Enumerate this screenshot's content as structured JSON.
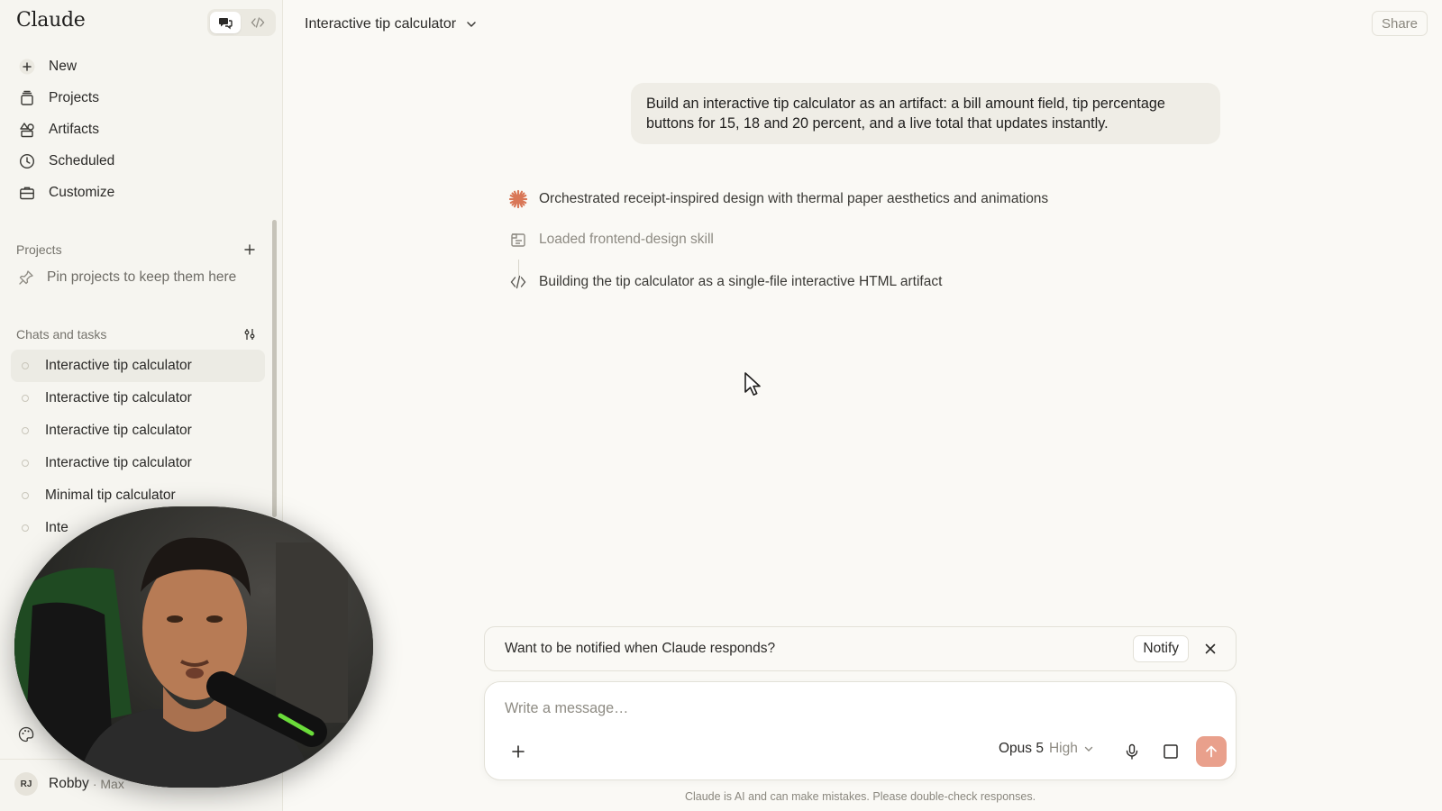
{
  "sidebar": {
    "brand": "Claude",
    "nav": [
      {
        "label": "New",
        "icon": "plus-icon"
      },
      {
        "label": "Projects",
        "icon": "projects-icon"
      },
      {
        "label": "Artifacts",
        "icon": "artifacts-icon"
      },
      {
        "label": "Scheduled",
        "icon": "clock-icon"
      },
      {
        "label": "Customize",
        "icon": "briefcase-icon"
      }
    ],
    "projects_header": "Projects",
    "pin_hint": "Pin projects to keep them here",
    "chats_header": "Chats and tasks",
    "chats": [
      {
        "title": "Interactive tip calculator"
      },
      {
        "title": "Interactive tip calculator"
      },
      {
        "title": "Interactive tip calculator"
      },
      {
        "title": "Interactive tip calculator"
      },
      {
        "title": "Minimal tip calculator"
      },
      {
        "title": "Inte"
      }
    ],
    "user": {
      "initials": "RJ",
      "name": "Robby",
      "plan": "· Max"
    }
  },
  "header": {
    "chat_title": "Interactive tip calculator",
    "share_label": "Share"
  },
  "conversation": {
    "user_message": "Build an interactive tip calculator as an artifact: a bill amount field, tip percentage buttons for 15, 18 and 20 percent, and a live total that updates instantly.",
    "steps": [
      {
        "text": "Orchestrated receipt-inspired design with thermal paper aesthetics and animations",
        "icon": "claude-spark-icon"
      },
      {
        "text": "Loaded frontend-design skill",
        "icon": "skill-file-icon"
      },
      {
        "text": "Building the tip calculator as a single-file interactive HTML artifact",
        "icon": "code-icon"
      }
    ]
  },
  "notify": {
    "text": "Want to be notified when Claude responds?",
    "button_label": "Notify"
  },
  "composer": {
    "placeholder": "Write a message…",
    "model": "Opus 5",
    "effort": "High"
  },
  "footer": {
    "disclaimer": "Claude is AI and can make mistakes. Please double-check responses."
  },
  "colors": {
    "accent": "#d97757",
    "send_button": "#e9a08c",
    "background": "#faf9f5",
    "sidebar": "#f6f5f0"
  }
}
